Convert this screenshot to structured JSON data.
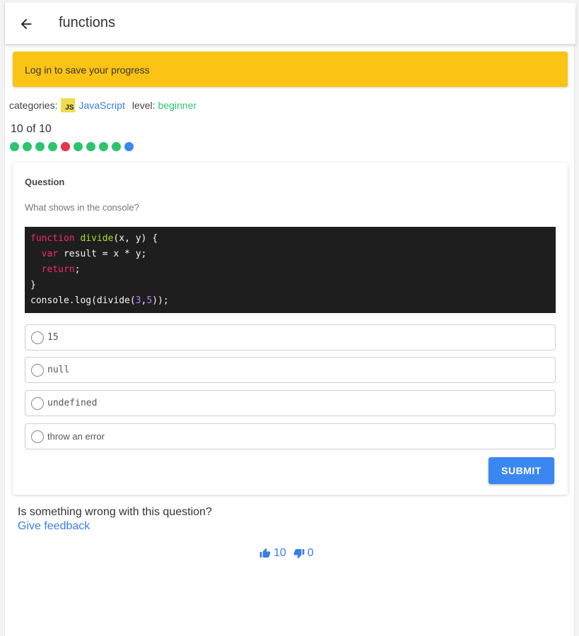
{
  "header": {
    "title": "functions",
    "back_icon": "arrow-left-icon"
  },
  "banner": {
    "text": "Log in to save your progress",
    "color": "#fbc314"
  },
  "meta": {
    "categories_label": "categories:",
    "category_badge": "JS",
    "category_name": "JavaScript",
    "level_label": "level:",
    "level_value": "beginner"
  },
  "progress": {
    "text": "10 of 10",
    "dots": [
      "correct",
      "correct",
      "correct",
      "correct",
      "incorrect",
      "correct",
      "correct",
      "correct",
      "correct",
      "current"
    ],
    "colors": {
      "correct": "#2ec46d",
      "incorrect": "#e6344f",
      "current": "#3a87f2"
    }
  },
  "question": {
    "heading": "Question",
    "prompt": "What shows in the console?",
    "code_lines": [
      "function divide(x, y) {",
      "  var result = x * y;",
      "  return;",
      "}",
      "console.log(divide(3,5));"
    ],
    "options": [
      "15",
      "null",
      "undefined",
      "throw an error"
    ],
    "submit_label": "SUBMIT"
  },
  "feedback": {
    "question": "Is something wrong with this question?",
    "link": "Give feedback",
    "upvotes": "10",
    "downvotes": "0",
    "up_icon": "thumbs-up-icon",
    "down_icon": "thumbs-down-icon"
  }
}
